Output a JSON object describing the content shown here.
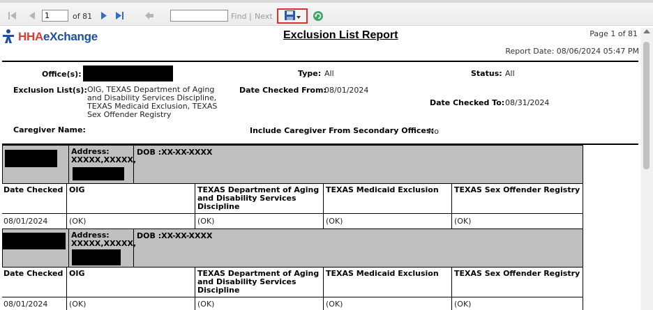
{
  "toolbar": {
    "current_page": "1",
    "of_total": "of 81",
    "find_label": "Find",
    "separator": "|",
    "next_label": "Next"
  },
  "logo": {
    "part1": "HHA",
    "part2": "eXchange"
  },
  "report": {
    "title": "Exclusion List Report",
    "page_info": "Page  1 of 81",
    "report_date": "Report Date:  08/06/2024 05:47 PM"
  },
  "criteria": {
    "office_label": "Office(s):",
    "type_label": "Type:",
    "type_value": "All",
    "status_label": "Status:",
    "status_value": "All",
    "exclusion_label": "Exclusion List(s):",
    "exclusion_value_lines": [
      "OIG, TEXAS Department of Aging",
      "and Disability Services Discipline,",
      "TEXAS Medicaid Exclusion, TEXAS",
      "Sex Offender Registry"
    ],
    "date_from_label": "Date Checked From:",
    "date_from_value": "08/01/2024",
    "date_to_label": "Date Checked To:",
    "date_to_value": "08/31/2024",
    "caregiver_label": "Caregiver Name:",
    "secondary_label": "Include Caregiver From Secondary Offices:",
    "secondary_value": "No"
  },
  "caregivers": [
    {
      "address_label": "Address:",
      "address_value": "XXXXX,XXXXX,",
      "dob": "DOB :XX-XX-XXXX",
      "date_checked": "08/01/2024",
      "oig": "(OK)",
      "texas_aging": "(OK)",
      "texas_medicaid": "(OK)",
      "texas_sex_offender": "(OK)"
    },
    {
      "address_label": "Address:",
      "address_value": "XXXXX,XXXXX,",
      "dob": "DOB :XX-XX-XXXX",
      "date_checked": "08/01/2024",
      "oig": "(OK)",
      "texas_aging": "(OK)",
      "texas_medicaid": "(OK)",
      "texas_sex_offender": "(OK)"
    }
  ],
  "columns": {
    "date_checked": "Date Checked",
    "oig": "OIG",
    "texas_aging_lines": [
      "TEXAS Department of Aging",
      "and Disability Services",
      "Discipline"
    ],
    "texas_medicaid": "TEXAS Medicaid Exclusion",
    "texas_sex_offender": "TEXAS Sex Offender Registry"
  },
  "colors": {
    "brand_blue": "#1e4f9c",
    "brand_red": "#e03a32",
    "header_gray": "#c0c0c0",
    "highlight": "#d9312b"
  }
}
